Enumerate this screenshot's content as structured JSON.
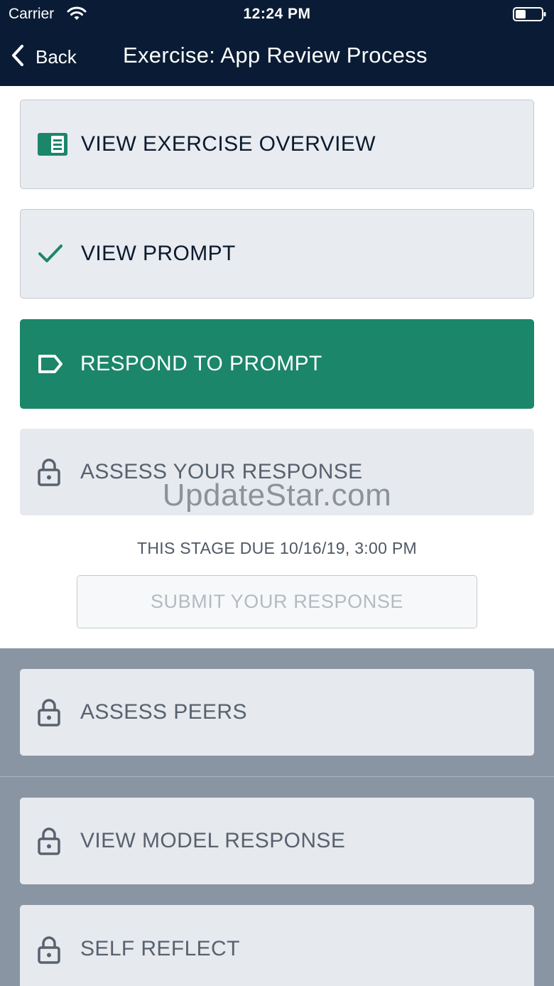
{
  "status_bar": {
    "carrier": "Carrier",
    "time": "12:24 PM",
    "wifi_icon": "wifi-icon",
    "battery_icon": "battery-icon"
  },
  "nav": {
    "back_label": "Back",
    "title": "Exercise: App Review Process"
  },
  "stages": [
    {
      "label": "VIEW EXERCISE OVERVIEW",
      "icon": "book-icon",
      "state": "available"
    },
    {
      "label": "VIEW PROMPT",
      "icon": "checkmark-icon",
      "state": "completed"
    },
    {
      "label": "RESPOND TO PROMPT",
      "icon": "tag-icon",
      "state": "active"
    },
    {
      "label": "ASSESS YOUR RESPONSE",
      "icon": "lock-icon",
      "state": "locked"
    },
    {
      "label": "ASSESS PEERS",
      "icon": "lock-icon",
      "state": "locked"
    },
    {
      "label": "VIEW MODEL RESPONSE",
      "icon": "lock-icon",
      "state": "locked"
    },
    {
      "label": "SELF REFLECT",
      "icon": "lock-icon",
      "state": "locked"
    }
  ],
  "stage_due": "THIS STAGE DUE 10/16/19, 3:00 PM",
  "submit_label": "SUBMIT YOUR RESPONSE",
  "watermark": "UpdateStar.com",
  "colors": {
    "header_bg": "#0a1c35",
    "accent_green": "#1b8669",
    "card_bg": "#e8ebf0",
    "locked_section_bg": "#8a95a3"
  }
}
